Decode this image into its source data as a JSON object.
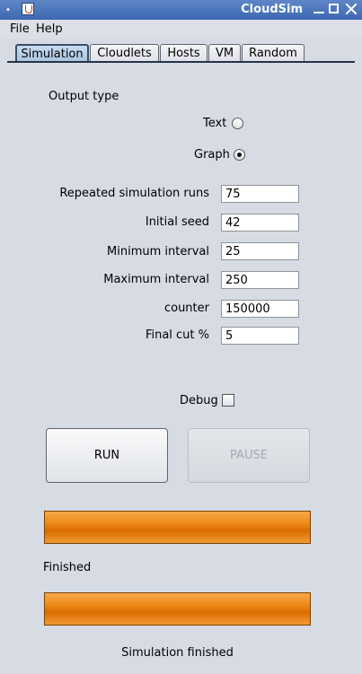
{
  "window": {
    "title": "CloudSim"
  },
  "menubar": {
    "file": "File",
    "help": "Help"
  },
  "tabs": [
    {
      "label": "Simulation",
      "active": true
    },
    {
      "label": "Cloudlets"
    },
    {
      "label": "Hosts"
    },
    {
      "label": "VM"
    },
    {
      "label": "Random"
    }
  ],
  "output": {
    "label": "Output type",
    "text_option": "Text",
    "graph_option": "Graph",
    "selected": "Graph"
  },
  "fields": [
    {
      "label": "Repeated simulation runs",
      "value": "75"
    },
    {
      "label": "Initial seed",
      "value": "42"
    },
    {
      "label": "Minimum interval",
      "value": "25"
    },
    {
      "label": "Maximum interval",
      "value": "250"
    },
    {
      "label": "counter",
      "value": "150000"
    },
    {
      "label": "Final cut %",
      "value": "5"
    }
  ],
  "debug": {
    "label": "Debug",
    "checked": false
  },
  "buttons": {
    "run": "RUN",
    "pause": "PAUSE",
    "pause_enabled": false
  },
  "progress1": {
    "status": "Finished",
    "fraction": 1.0
  },
  "progress2": {
    "status": "Simulation finished",
    "fraction": 1.0
  },
  "colors": {
    "progress": "#ed8716",
    "selected_tab": "#a9c4e0",
    "titlebar": "#3d68b1"
  }
}
